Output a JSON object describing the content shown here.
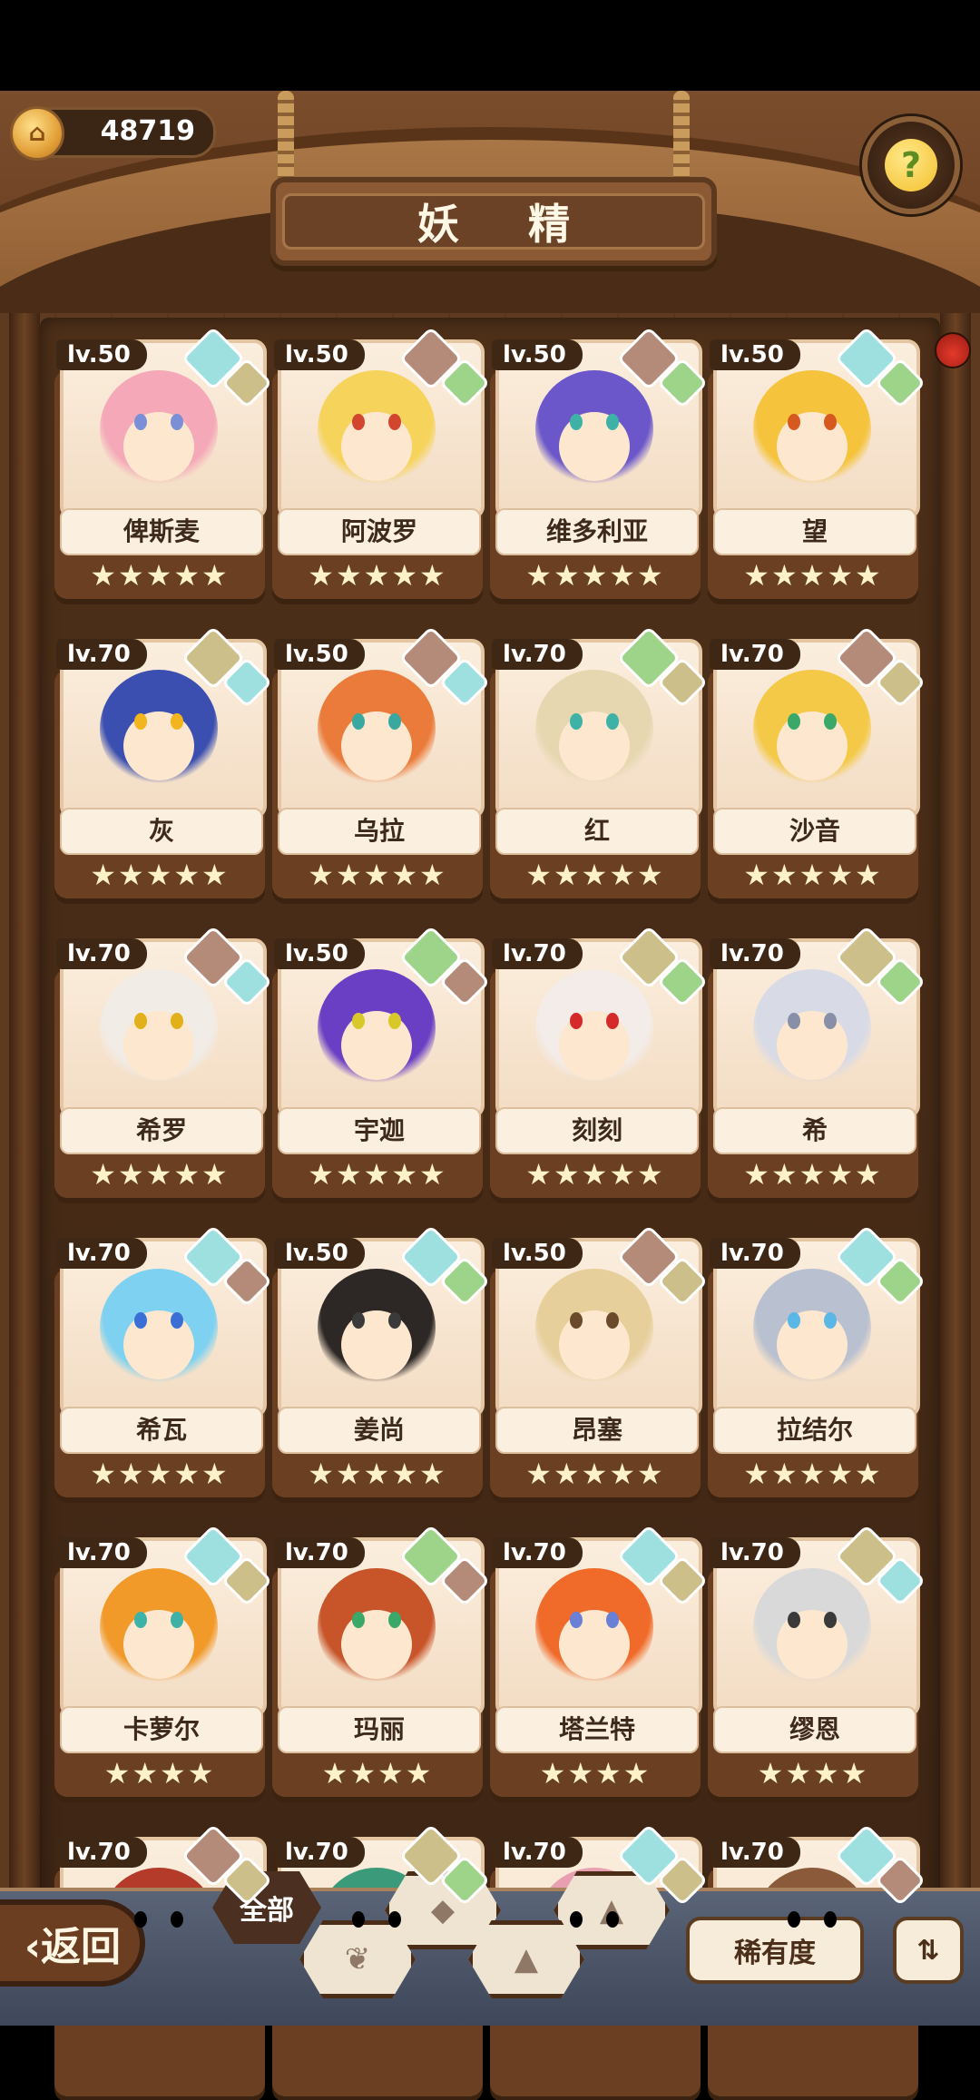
{
  "header": {
    "coins": "48719",
    "title": "妖 精",
    "help_icon": "question-sprout-icon"
  },
  "elements": {
    "water": "#9edfe0",
    "earth": "#cdbf89",
    "rock": "#b38b78",
    "plant": "#9ed38a"
  },
  "fairies": [
    {
      "level": "lv.50",
      "name": "俾斯麦",
      "stars": "★★★★★",
      "e1": "water",
      "e2": "earth",
      "hair": "#f5a8b8",
      "eyes": "#7a8fd6"
    },
    {
      "level": "lv.50",
      "name": "阿波罗",
      "stars": "★★★★★",
      "e1": "rock",
      "e2": "plant",
      "hair": "#f6d35b",
      "eyes": "#d2462f"
    },
    {
      "level": "lv.50",
      "name": "维多利亚",
      "stars": "★★★★★",
      "e1": "rock",
      "e2": "plant",
      "hair": "#6b57c9",
      "eyes": "#3fb2a8"
    },
    {
      "level": "lv.50",
      "name": "望",
      "stars": "★★★★★",
      "e1": "water",
      "e2": "plant",
      "hair": "#f5c33c",
      "eyes": "#d65a1f"
    },
    {
      "level": "lv.70",
      "name": "灰",
      "stars": "★★★★★",
      "e1": "earth",
      "e2": "water",
      "hair": "#3b4fb0",
      "eyes": "#f2b51e"
    },
    {
      "level": "lv.50",
      "name": "乌拉",
      "stars": "★★★★★",
      "e1": "rock",
      "e2": "water",
      "hair": "#ea7b3a",
      "eyes": "#3aa8a0"
    },
    {
      "level": "lv.70",
      "name": "红",
      "stars": "★★★★★",
      "e1": "plant",
      "e2": "earth",
      "hair": "#e6d7b0",
      "eyes": "#3fb2a8"
    },
    {
      "level": "lv.70",
      "name": "沙音",
      "stars": "★★★★★",
      "e1": "rock",
      "e2": "earth",
      "hair": "#f4c947",
      "eyes": "#3aa868"
    },
    {
      "level": "lv.70",
      "name": "希罗",
      "stars": "★★★★★",
      "e1": "rock",
      "e2": "water",
      "hair": "#f1ece6",
      "eyes": "#e2b01a"
    },
    {
      "level": "lv.50",
      "name": "宇迦",
      "stars": "★★★★★",
      "e1": "plant",
      "e2": "rock",
      "hair": "#6b3fc4",
      "eyes": "#d8c82a"
    },
    {
      "level": "lv.70",
      "name": "刻刻",
      "stars": "★★★★★",
      "e1": "earth",
      "e2": "plant",
      "hair": "#f3ece8",
      "eyes": "#d62a2a"
    },
    {
      "level": "lv.70",
      "name": "希",
      "stars": "★★★★★",
      "e1": "earth",
      "e2": "plant",
      "hair": "#d8dbe6",
      "eyes": "#8a8fa8"
    },
    {
      "level": "lv.70",
      "name": "希瓦",
      "stars": "★★★★★",
      "e1": "water",
      "e2": "rock",
      "hair": "#7ed1f0",
      "eyes": "#3a6fd6"
    },
    {
      "level": "lv.50",
      "name": "姜尚",
      "stars": "★★★★★",
      "e1": "water",
      "e2": "plant",
      "hair": "#2d2826",
      "eyes": "#3a3a3a"
    },
    {
      "level": "lv.50",
      "name": "昂塞",
      "stars": "★★★★★",
      "e1": "rock",
      "e2": "earth",
      "hair": "#e6cf9a",
      "eyes": "#6a4a2a"
    },
    {
      "level": "lv.70",
      "name": "拉结尔",
      "stars": "★★★★★",
      "e1": "water",
      "e2": "plant",
      "hair": "#b9c0cf",
      "eyes": "#5ab7e6"
    },
    {
      "level": "lv.70",
      "name": "卡萝尔",
      "stars": "★★★★",
      "e1": "water",
      "e2": "earth",
      "hair": "#f19a2a",
      "eyes": "#3fb2a8"
    },
    {
      "level": "lv.70",
      "name": "玛丽",
      "stars": "★★★★",
      "e1": "plant",
      "e2": "rock",
      "hair": "#c8552a",
      "eyes": "#3aa868"
    },
    {
      "level": "lv.70",
      "name": "塔兰特",
      "stars": "★★★★",
      "e1": "water",
      "e2": "earth",
      "hair": "#f06a2a",
      "eyes": "#6a7fd6"
    },
    {
      "level": "lv.70",
      "name": "缪恩",
      "stars": "★★★★",
      "e1": "earth",
      "e2": "water",
      "hair": "#d9d9d9",
      "eyes": "#3a3a3a"
    },
    {
      "level": "lv.70",
      "name": "",
      "stars": "",
      "e1": "rock",
      "e2": "earth",
      "hair": "#b43a2a",
      "eyes": "#000"
    },
    {
      "level": "lv.70",
      "name": "",
      "stars": "",
      "e1": "earth",
      "e2": "plant",
      "hair": "#3a9a7a",
      "eyes": "#000"
    },
    {
      "level": "lv.70",
      "name": "",
      "stars": "",
      "e1": "water",
      "e2": "earth",
      "hair": "#e8a0b0",
      "eyes": "#000"
    },
    {
      "level": "lv.70",
      "name": "",
      "stars": "",
      "e1": "water",
      "e2": "rock",
      "hair": "#8a5a3a",
      "eyes": "#000"
    }
  ],
  "bottom": {
    "back_label": "‹返回",
    "filter_all": "全部",
    "filter_icons": [
      "water-drop-icon",
      "sprout-icon",
      "mountain-icon",
      "rock-icon"
    ],
    "sort_label": "稀有度",
    "order_icon": "sort-order-icon"
  }
}
